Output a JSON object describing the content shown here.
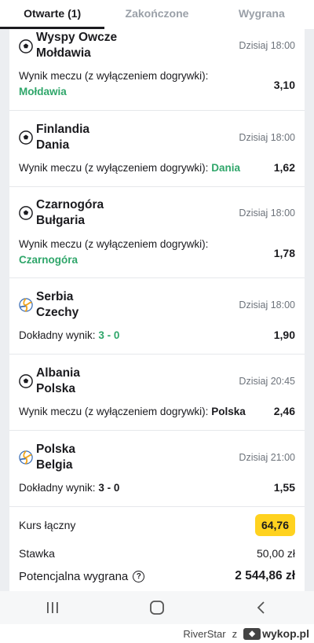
{
  "tabs": [
    {
      "label": "Otwarte (1)",
      "active": true
    },
    {
      "label": "Zakończone",
      "active": false
    },
    {
      "label": "Wygrana",
      "active": false
    }
  ],
  "events": [
    {
      "sport_icon": "football-icon",
      "home": "Wyspy Owcze",
      "away": "Mołdawia",
      "time": "Dzisiaj 18:00",
      "market": "Wynik meczu (z wyłączeniem dogrywki):",
      "pick": "Mołdawia",
      "odds": "3,10"
    },
    {
      "sport_icon": "football-icon",
      "home": "Finlandia",
      "away": "Dania",
      "time": "Dzisiaj 18:00",
      "market": "Wynik meczu (z wyłączeniem dogrywki):",
      "pick": "Dania",
      "odds": "1,62"
    },
    {
      "sport_icon": "football-icon",
      "home": "Czarnogóra",
      "away": "Bułgaria",
      "time": "Dzisiaj 18:00",
      "market": "Wynik meczu (z wyłączeniem dogrywki):",
      "pick": "Czarnogóra",
      "odds": "1,78"
    },
    {
      "sport_icon": "volleyball-icon",
      "home": "Serbia",
      "away": "Czechy",
      "time": "Dzisiaj 18:00",
      "market": "Dokładny wynik:",
      "pick": "3 - 0",
      "odds": "1,90"
    },
    {
      "sport_icon": "football-icon",
      "home": "Albania",
      "away": "Polska",
      "time": "Dzisiaj 20:45",
      "market": "Wynik meczu (z wyłączeniem dogrywki):",
      "pick": "Polska",
      "odds": "2,46"
    },
    {
      "sport_icon": "volleyball-icon",
      "home": "Polska",
      "away": "Belgia",
      "time": "Dzisiaj 21:00",
      "market": "Dokładny wynik:",
      "pick": "3 - 0",
      "odds": "1,55"
    }
  ],
  "summary": {
    "total_odds_label": "Kurs łączny",
    "total_odds": "64,76",
    "stake_label": "Stawka",
    "stake": "50,00 zł",
    "potential_label": "Potencjalna wygrana",
    "potential": "2 544,86 zł"
  },
  "navbar": {
    "icons": [
      "recent-apps-icon",
      "home-icon",
      "back-icon"
    ]
  },
  "footer": {
    "user": "RiverStar",
    "sep": "z",
    "site": "wykop.pl"
  },
  "colors": {
    "pick_green": "#2fa66a",
    "badge_yellow": "#ffd21f"
  }
}
